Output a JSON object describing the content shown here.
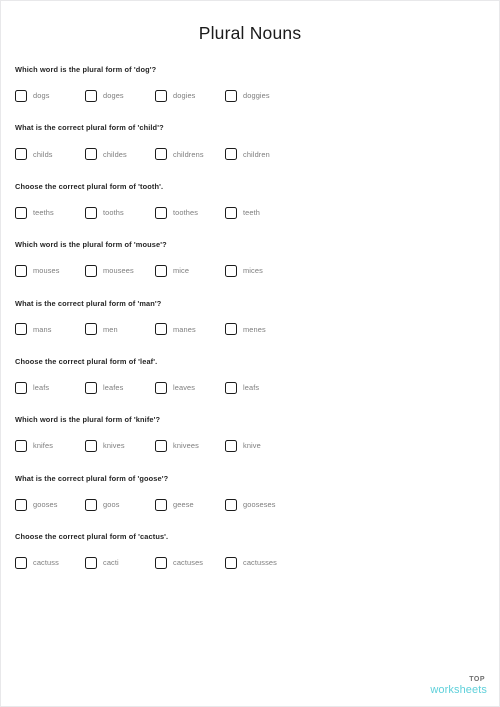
{
  "worksheet": {
    "title": "Plural Nouns",
    "questions": [
      {
        "prompt": "Which word is the plural form of 'dog'?",
        "options": [
          "dogs",
          "doges",
          "dogies",
          "doggies"
        ]
      },
      {
        "prompt": "What is the correct plural form of 'child'?",
        "options": [
          "childs",
          "childes",
          "childrens",
          "children"
        ]
      },
      {
        "prompt": "Choose the correct plural form of 'tooth'.",
        "options": [
          "teeths",
          "tooths",
          "toothes",
          "teeth"
        ]
      },
      {
        "prompt": "Which word is the plural form of 'mouse'?",
        "options": [
          "mouses",
          "mousees",
          "mice",
          "mices"
        ]
      },
      {
        "prompt": "What is the correct plural form of 'man'?",
        "options": [
          "mans",
          "men",
          "manes",
          "menes"
        ]
      },
      {
        "prompt": "Choose the correct plural form of 'leaf'.",
        "options": [
          "leafs",
          "leafes",
          "leaves",
          "leafs"
        ]
      },
      {
        "prompt": "Which word is the plural form of 'knife'?",
        "options": [
          "knifes",
          "knives",
          "knivees",
          "knive"
        ]
      },
      {
        "prompt": "What is the correct plural form of 'goose'?",
        "options": [
          "gooses",
          "goos",
          "geese",
          "gooseses"
        ]
      },
      {
        "prompt": "Choose the correct plural form of 'cactus'.",
        "options": [
          "cactuss",
          "cacti",
          "cactuses",
          "cactusses"
        ]
      }
    ]
  },
  "footer": {
    "logo_top": "TOP",
    "logo_bottom": "worksheets",
    "brand_color": "#5ed0da",
    "top_color": "#6f6f6f"
  }
}
